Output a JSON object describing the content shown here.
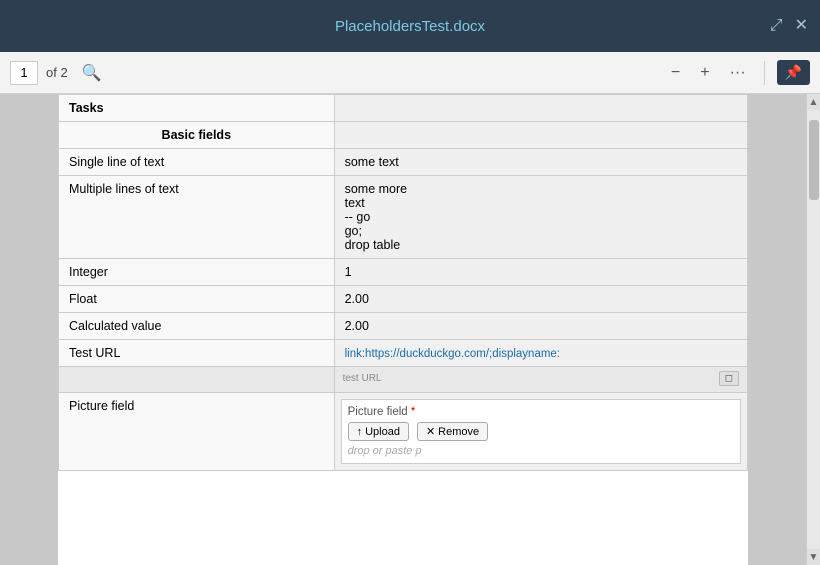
{
  "titlebar": {
    "title": "PlaceholdersTest.docx",
    "expand_icon": "⤢",
    "close_icon": "✕"
  },
  "toolbar": {
    "page_current": "1",
    "page_total": "of 2",
    "search_icon": "🔍",
    "zoom_out_icon": "−",
    "zoom_in_icon": "+",
    "more_icon": "···",
    "pin_icon": "📌"
  },
  "document": {
    "table": {
      "section_label": "Tasks",
      "group_label": "Basic fields",
      "rows": [
        {
          "label": "Single line of text",
          "value": "some text",
          "type": "simple"
        },
        {
          "label": "Multiple lines of text",
          "value": "some more\ntext\n-- go\ngo;\ndrop table",
          "type": "multiline"
        },
        {
          "label": "Integer",
          "value": "1",
          "type": "simple"
        },
        {
          "label": "Float",
          "value": "2.00",
          "type": "simple"
        },
        {
          "label": "Calculated value",
          "value": "2.00",
          "type": "simple"
        },
        {
          "label": "Test URL",
          "value": "link:https://duckduckgo.com/;displayname:",
          "type": "url"
        },
        {
          "label": "Picture field",
          "value": "",
          "type": "picture"
        }
      ],
      "multiline_lines": [
        "some more",
        "text",
        "-- go",
        "go;",
        "drop table"
      ],
      "picture_field": {
        "label": "Picture field",
        "required_star": "*",
        "upload_btn": "↑ Upload",
        "remove_btn": "✕ Remove",
        "drop_text": "drop or paste p"
      }
    }
  }
}
